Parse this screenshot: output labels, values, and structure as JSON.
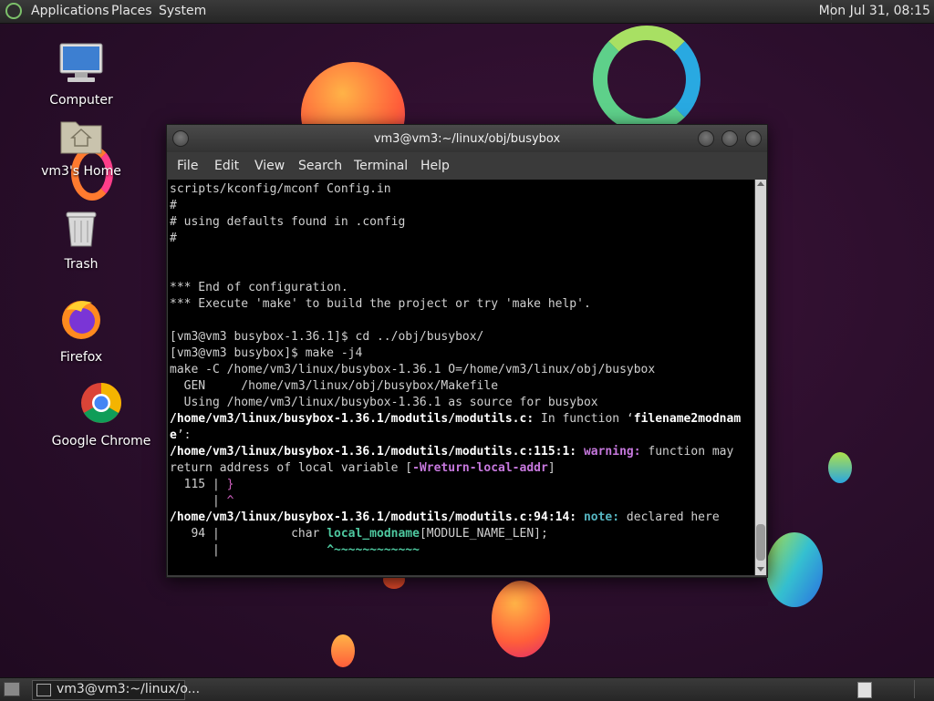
{
  "top_panel": {
    "menus": [
      "Applications",
      "Places",
      "System"
    ],
    "clock": "Mon Jul 31, 08:15"
  },
  "desktop_icons": [
    {
      "label": "Computer",
      "icon": "computer-icon"
    },
    {
      "label": "vm3's Home",
      "icon": "home-folder-icon"
    },
    {
      "label": "Trash",
      "icon": "trash-icon"
    },
    {
      "label": "Firefox",
      "icon": "firefox-icon"
    },
    {
      "label": "Google Chrome",
      "icon": "chrome-icon"
    }
  ],
  "terminal": {
    "title": "vm3@vm3:~/linux/obj/busybox",
    "menus": [
      "File",
      "Edit",
      "View",
      "Search",
      "Terminal",
      "Help"
    ],
    "lines": [
      "scripts/kconfig/mconf Config.in",
      "#",
      "# using defaults found in .config",
      "#",
      "",
      "",
      "*** End of configuration.",
      "*** Execute 'make' to build the project or try 'make help'.",
      "",
      "[vm3@vm3 busybox-1.36.1]$ cd ../obj/busybox/",
      "[vm3@vm3 busybox]$ make -j4",
      "make -C /home/vm3/linux/busybox-1.36.1 O=/home/vm3/linux/obj/busybox",
      "  GEN     /home/vm3/linux/obj/busybox/Makefile",
      "  Using /home/vm3/linux/busybox-1.36.1 as source for busybox"
    ],
    "err1_path": "/home/vm3/linux/busybox-1.36.1/modutils/modutils.c:",
    "err1_text": " In function ‘",
    "err1_func": "filename2modnam",
    "err1_cont": "e",
    "err1_end": "’:",
    "warn_path": "/home/vm3/linux/busybox-1.36.1/modutils/modutils.c:115:1:",
    "warn_label": " warning:",
    "warn_text": " function may",
    "warn_line2a": "return address of local variable [",
    "warn_flag": "-Wreturn-local-addr",
    "warn_line2b": "]",
    "src1_num": "  115 | ",
    "src1_code": "}",
    "src1_gutter": "      | ",
    "src1_caret": "^",
    "note_path": "/home/vm3/linux/busybox-1.36.1/modutils/modutils.c:94:14:",
    "note_label": " note:",
    "note_text": " declared here",
    "src2_num": "   94 | ",
    "src2_pre": "         char ",
    "src2_var": "local_modname",
    "src2_post": "[MODULE_NAME_LEN];",
    "src2_gutter": "      | ",
    "src2_pad": "              ",
    "src2_caret": "^~~~~~~~~~~~~"
  },
  "taskbar": {
    "task_label": "vm3@vm3:~/linux/o..."
  },
  "colors": {
    "warning": "#c678dd",
    "note": "#56b6c2",
    "highlight": "#4ec9a0",
    "caret": "#d060c0"
  }
}
